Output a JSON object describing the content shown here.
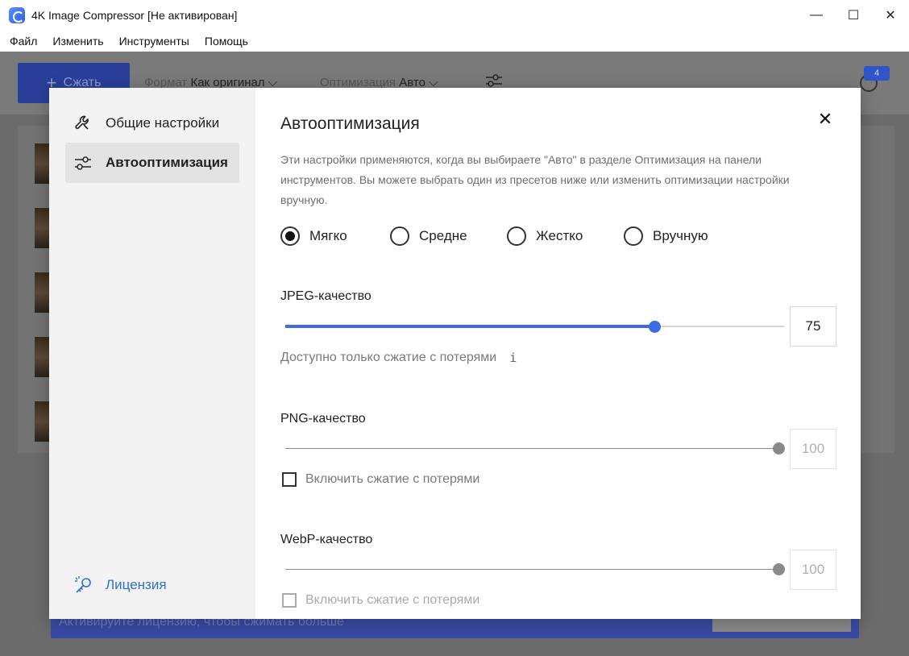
{
  "window": {
    "title": "4K Image Compressor [Не активирован]",
    "minimize": "—",
    "maximize": "☐",
    "close": "✕"
  },
  "menu": [
    "Файл",
    "Изменить",
    "Инструменты",
    "Помощь"
  ],
  "toolbar": {
    "compress_label": "Сжать",
    "format_label": "Формат",
    "format_value": "Как оригинал",
    "optimization_label": "Оптимизация",
    "optimization_value": "Авто",
    "badge_count": "4"
  },
  "banner": {
    "text": "Активируйте лицензию, чтобы сжимать больше"
  },
  "sidebar": {
    "items": [
      {
        "label": "Общие настройки",
        "icon": "wrench-icon"
      },
      {
        "label": "Автооптимизация",
        "icon": "sliders-icon"
      }
    ],
    "license_label": "Лицензия"
  },
  "panel": {
    "title": "Автооптимизация",
    "close": "✕",
    "description": "Эти настройки применяются, когда вы выбираете \"Авто\" в разделе Оптимизация на панели инструментов. Вы можете выбрать один из пресетов ниже или изменить оптимизации настройки вручную.",
    "presets": [
      {
        "label": "Мягко",
        "selected": true
      },
      {
        "label": "Средне",
        "selected": false
      },
      {
        "label": "Жестко",
        "selected": false
      },
      {
        "label": "Вручную",
        "selected": false
      }
    ],
    "jpeg": {
      "label": "JPEG-качество",
      "value": "75",
      "level": 0.74,
      "hint": "Доступно только сжатие с потерями",
      "info_icon": "i"
    },
    "png": {
      "label": "PNG-качество",
      "value": "100",
      "level": 1.0,
      "checkbox_label": "Включить сжатие с потерями"
    },
    "webp": {
      "label": "WebP-качество",
      "value": "100",
      "level": 1.0,
      "checkbox_label": "Включить сжатие с потерями"
    }
  },
  "colors": {
    "accent": "#3f6ae8",
    "link": "#2f6fd6"
  }
}
